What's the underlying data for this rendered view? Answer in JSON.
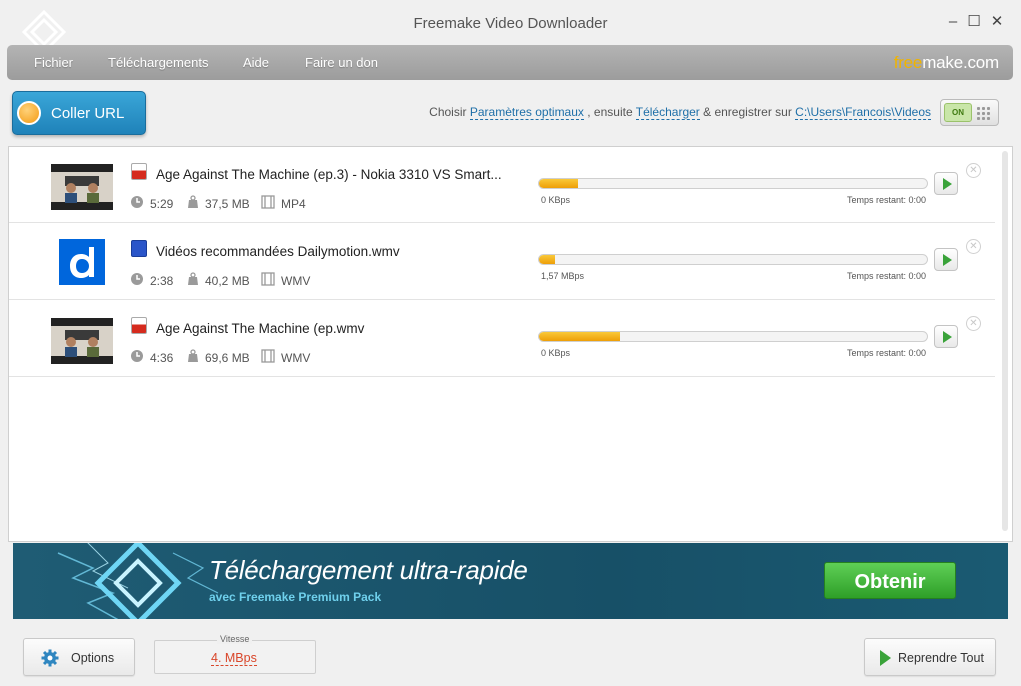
{
  "window": {
    "title": "Freemake Video Downloader",
    "minimize": "–",
    "maximize": "☐",
    "close": "✕"
  },
  "menu": {
    "items": [
      "Fichier",
      "Téléchargements",
      "Aide",
      "Faire un don"
    ],
    "brand_part1": "free",
    "brand_part2": "make.com"
  },
  "toolbar": {
    "paste_url_label": "Coller URL",
    "settings_prefix": "Choisir",
    "preset_link": "Paramètres optimaux",
    "then_text": ", ensuite",
    "action_link": "Télécharger",
    "save_text": "& enregistrer sur",
    "folder_link": "C:\\Users\\Francois\\Videos",
    "toggle_label": "ON"
  },
  "downloads": [
    {
      "title": "Age Against The Machine (ep.3) - Nokia 3310 VS Smart...",
      "source_icon": "youtube-icon",
      "duration": "5:29",
      "size": "37,5 MB",
      "format": "MP4",
      "progress": 0.1,
      "speed": "0  KBps",
      "remaining": "Temps restant: 0:00"
    },
    {
      "title": "Vidéos recommandées   Dailymotion.wmv",
      "source_icon": "dailymotion-icon",
      "duration": "2:38",
      "size": "40,2 MB",
      "format": "WMV",
      "progress": 0.04,
      "speed": "1,57  MBps",
      "remaining": "Temps restant: 0:00"
    },
    {
      "title": "Age Against The Machine (ep.wmv",
      "source_icon": "youtube-icon",
      "duration": "4:36",
      "size": "69,6 MB",
      "format": "WMV",
      "progress": 0.21,
      "speed": "0  KBps",
      "remaining": "Temps restant: 0:00"
    }
  ],
  "banner": {
    "title": "Téléchargement ultra-rapide",
    "subtitle": "avec Freemake Premium Pack",
    "button": "Obtenir"
  },
  "footer": {
    "options_label": "Options",
    "speed_caption": "Vitesse",
    "speed_value": "4. MBps",
    "resume_label": "Reprendre Tout"
  },
  "colors": {
    "accent_blue": "#1f82b9",
    "progress": "#ee9f08",
    "play_green": "#3aa33a",
    "banner_bg": "#175067"
  }
}
